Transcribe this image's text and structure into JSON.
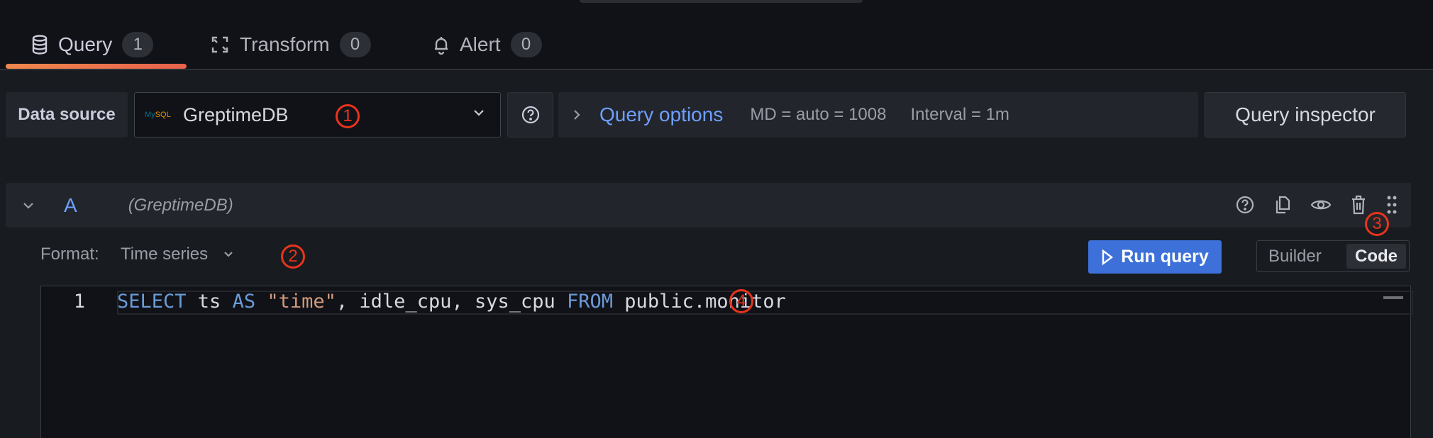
{
  "tabs": [
    {
      "label": "Query",
      "count": "1",
      "icon": "database-icon",
      "active": true
    },
    {
      "label": "Transform",
      "count": "0",
      "icon": "transform-icon"
    },
    {
      "label": "Alert",
      "count": "0",
      "icon": "bell-icon"
    }
  ],
  "toolbar": {
    "data_source_label": "Data source",
    "data_source_value": "GreptimeDB",
    "data_source_logo": "MySQL",
    "query_options_label": "Query options",
    "md": "MD = auto = 1008",
    "interval": "Interval = 1m",
    "query_inspector": "Query inspector"
  },
  "query": {
    "ref_id": "A",
    "datasource": "(GreptimeDB)",
    "format_label": "Format:",
    "format_value": "Time series",
    "run_label": "Run query",
    "builder_label": "Builder",
    "code_label": "Code",
    "mode_selected": "Code",
    "line_number": "1",
    "code": {
      "kw1": "SELECT",
      "t1": " ts ",
      "kw2": "AS",
      "t2": " ",
      "str": "\"time\"",
      "t3": ", idle_cpu, sys_cpu ",
      "kw3": "FROM",
      "t4": " public.monitor"
    }
  },
  "annotations": [
    "1",
    "2",
    "3",
    "4"
  ],
  "colors": {
    "accent": "#6e9fff",
    "primary_button": "#3d71d9",
    "annotation": "#e8341c",
    "tab_underline": "#f0884c"
  }
}
